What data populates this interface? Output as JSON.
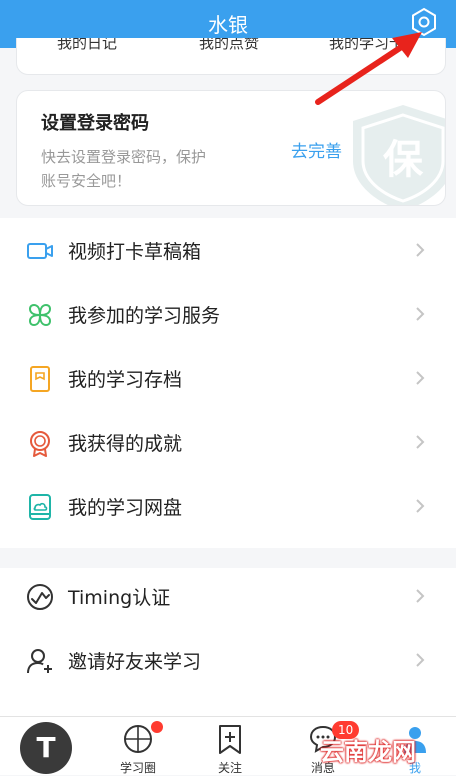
{
  "header": {
    "title": "水银"
  },
  "top_card": {
    "items": [
      "我的日记",
      "我的点赞",
      "我的学习卡"
    ]
  },
  "password_card": {
    "title": "设置登录密码",
    "desc_line1": "快去设置登录密码，保护",
    "desc_line2": "账号安全吧！",
    "link": "去完善",
    "shield_char": "保"
  },
  "menu": [
    {
      "label": "视频打卡草稿箱",
      "icon": "video-icon",
      "color": "#3aa0ee"
    },
    {
      "label": "我参加的学习服务",
      "icon": "clover-icon",
      "color": "#3ec16b"
    },
    {
      "label": "我的学习存档",
      "icon": "archive-icon",
      "color": "#f5a623"
    },
    {
      "label": "我获得的成就",
      "icon": "medal-icon",
      "color": "#e55a3c"
    },
    {
      "label": "我的学习网盘",
      "icon": "cloud-disk-icon",
      "color": "#1fb5a8"
    },
    {
      "label": "Timing认证",
      "icon": "verify-icon",
      "color": "#333333"
    },
    {
      "label": "邀请好友来学习",
      "icon": "invite-icon",
      "color": "#333333"
    }
  ],
  "tabbar": {
    "avatar_letter": "T",
    "tabs": [
      {
        "label": "学习圈"
      },
      {
        "label": "关注"
      },
      {
        "label": "消息",
        "badge": "10"
      },
      {
        "label": "我"
      }
    ]
  },
  "watermark": "云南龙网"
}
